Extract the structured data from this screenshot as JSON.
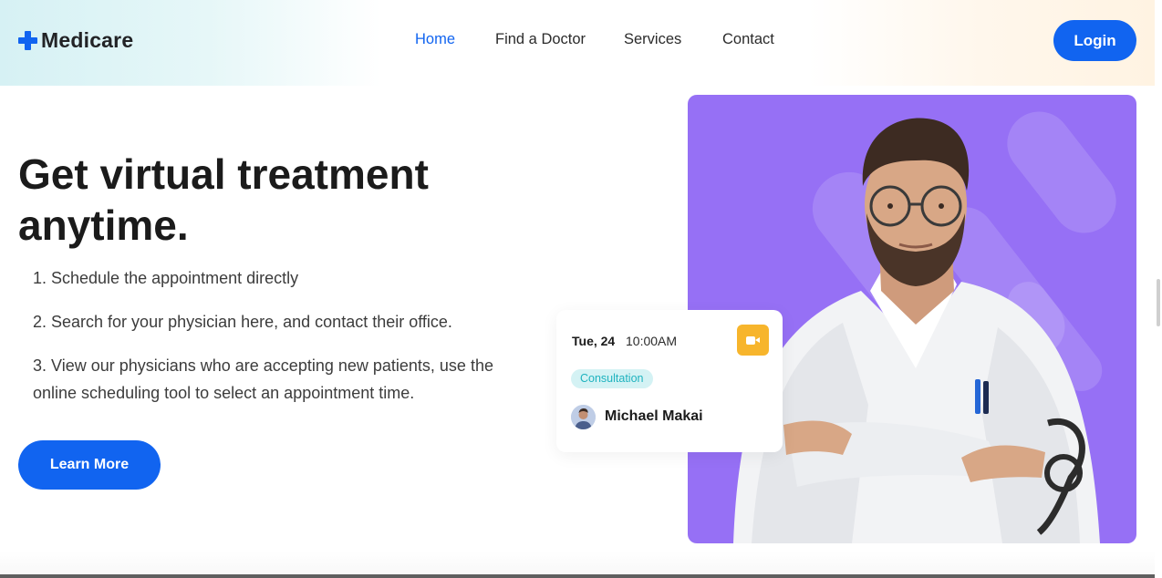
{
  "header": {
    "logo_text": "Medicare",
    "nav": [
      {
        "label": "Home",
        "active": true
      },
      {
        "label": "Find a Doctor",
        "active": false
      },
      {
        "label": "Services",
        "active": false
      },
      {
        "label": "Contact",
        "active": false
      }
    ],
    "login_label": "Login"
  },
  "hero": {
    "title": "Get virtual treatment anytime.",
    "steps": [
      "1. Schedule the appointment directly",
      "2. Search for your physician here, and contact their office.",
      "3. View our physicians who are accepting new patients, use the online scheduling tool to select an appointment time."
    ],
    "learn_more_label": "Learn More"
  },
  "appointment_card": {
    "date": "Tue, 24",
    "time": "10:00AM",
    "badge": "Consultation",
    "doctor_name": "Michael Makai",
    "icon": "video-camera-icon"
  },
  "colors": {
    "primary": "#1164f0",
    "image_background": "#9670f5",
    "video_button": "#f7b52c",
    "badge_background": "#d4f2f4",
    "badge_text": "#1fb3bf"
  }
}
